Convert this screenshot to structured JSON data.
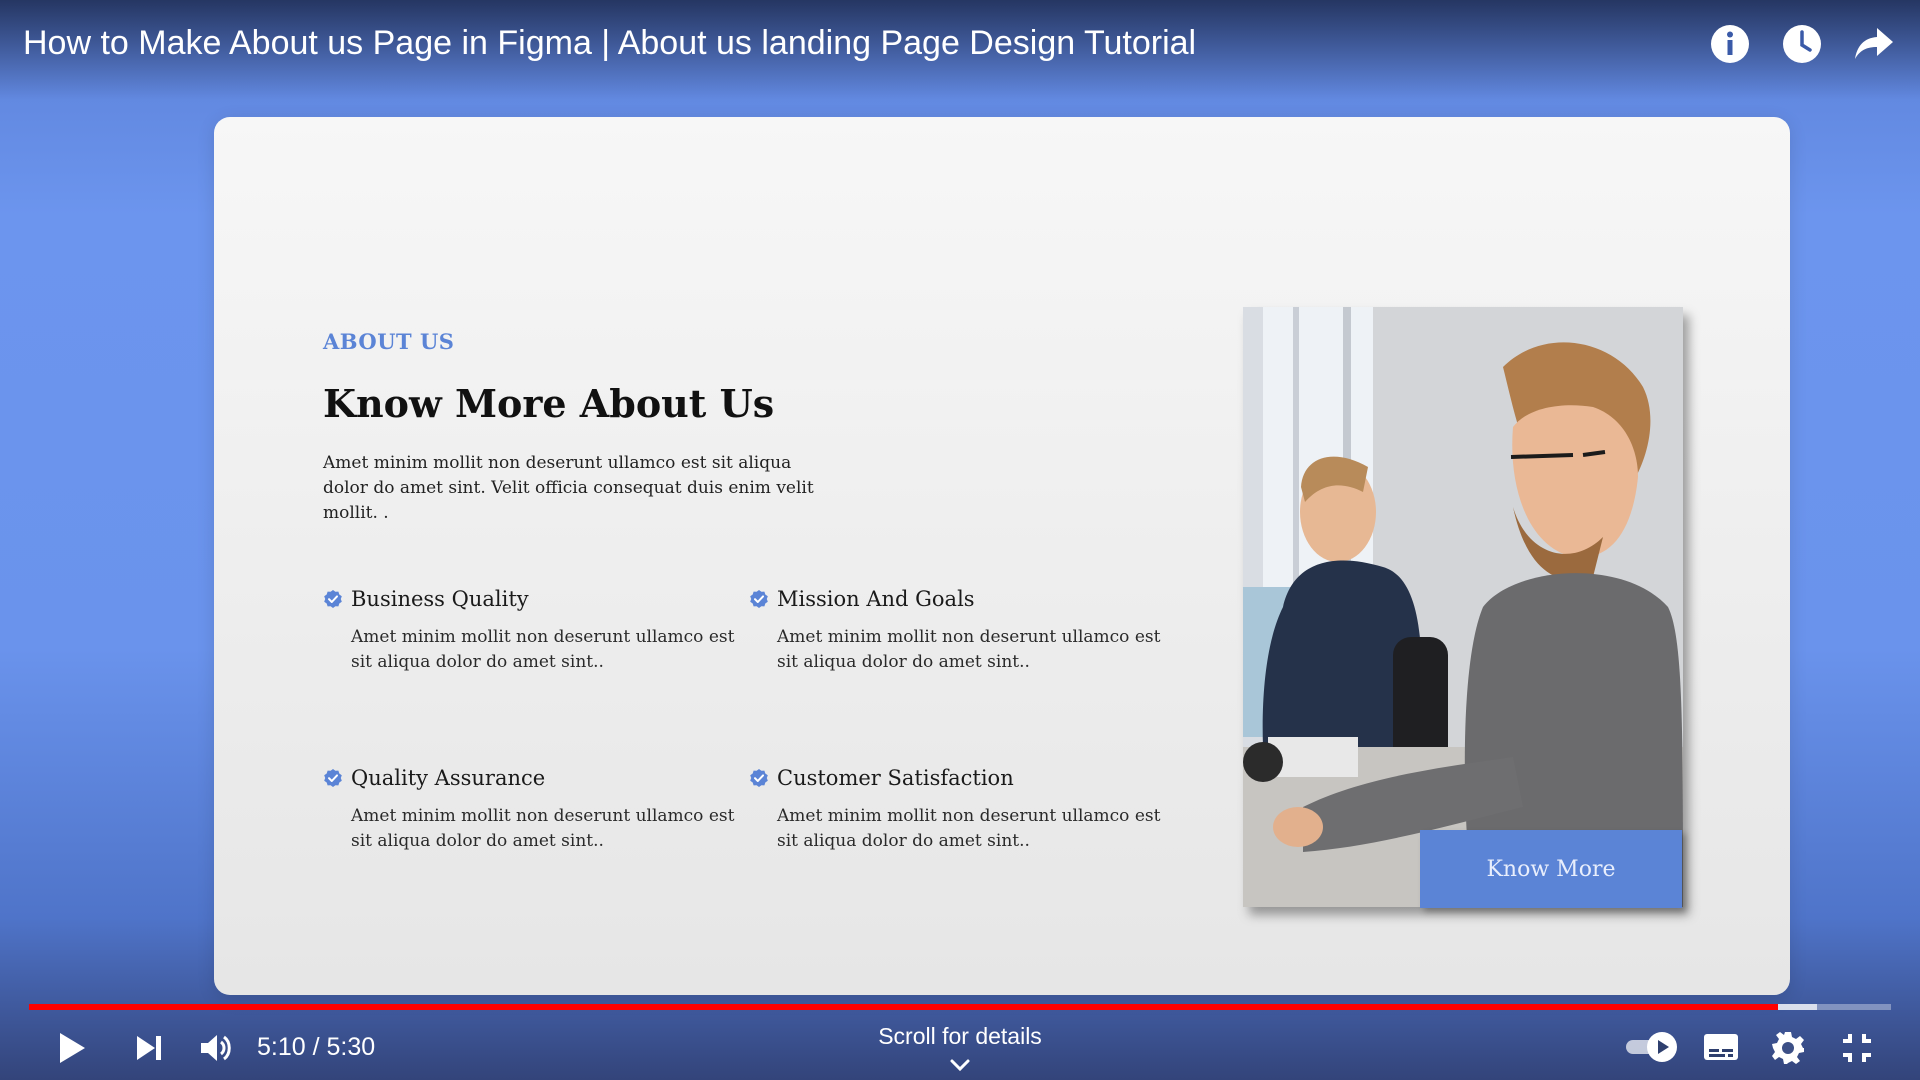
{
  "player": {
    "title": "How to Make About us Page in Figma | About us landing Page Design Tutorial",
    "time_display": "5:10 / 5:30",
    "progress_fraction": 0.9394,
    "buffered_fraction": 0.96,
    "scroll_hint": "Scroll for details",
    "colors": {
      "progress": "#ff0000",
      "accent": "#5b84d6"
    },
    "top_icons": [
      "info-icon",
      "clock-icon",
      "share-icon"
    ],
    "bottom_left_icons": [
      "play-icon",
      "next-icon",
      "volume-icon"
    ],
    "bottom_right_icons": [
      "autoplay-toggle-icon",
      "subtitles-icon",
      "settings-icon",
      "exit-fullscreen-icon"
    ]
  },
  "slide": {
    "eyebrow": "ABOUT US",
    "headline": "Know More About Us",
    "intro": "Amet minim mollit non deserunt ullamco est sit aliqua dolor do amet sint. Velit officia consequat duis enim velit mollit. .",
    "features": [
      {
        "title": "Business Quality",
        "desc": "Amet minim mollit non deserunt ullamco est sit aliqua dolor do amet sint.."
      },
      {
        "title": "Mission And Goals",
        "desc": "Amet minim mollit non deserunt ullamco est sit aliqua dolor do amet sint.."
      },
      {
        "title": "Quality Assurance",
        "desc": "Amet minim mollit non deserunt ullamco est sit aliqua dolor do amet sint.."
      },
      {
        "title": "Customer Satisfaction",
        "desc": "Amet minim mollit non deserunt ullamco est sit aliqua dolor do amet sint.."
      }
    ],
    "cta_label": "Know More"
  }
}
